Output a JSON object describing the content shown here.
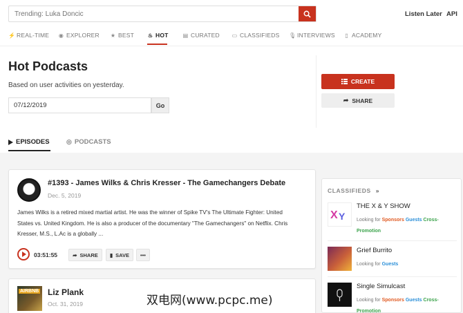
{
  "search": {
    "placeholder": "Trending: Luka Doncic"
  },
  "top_links": {
    "listen_later": "Listen Later",
    "api": "API"
  },
  "nav": [
    {
      "label": "REAL-TIME",
      "icon": "bolt-icon"
    },
    {
      "label": "EXPLORER",
      "icon": "compass-icon"
    },
    {
      "label": "BEST",
      "icon": "star-icon"
    },
    {
      "label": "HOT",
      "icon": "flame-icon",
      "active": true
    },
    {
      "label": "CURATED",
      "icon": "list-icon"
    },
    {
      "label": "CLASSIFIEDS",
      "icon": "card-icon"
    },
    {
      "label": "INTERVIEWS",
      "icon": "microphone-icon"
    },
    {
      "label": "ACADEMY",
      "icon": "book-icon"
    }
  ],
  "hero": {
    "title": "Hot Podcasts",
    "subtitle": "Based on user activities on yesterday.",
    "date_value": "07/12/2019",
    "go_label": "Go",
    "create_label": "CREATE",
    "share_label": "SHARE"
  },
  "tabs": {
    "episodes": "EPISODES",
    "podcasts": "PODCASTS"
  },
  "episodes": [
    {
      "title": "#1393 - James Wilks & Chris Kresser - The Gamechangers Debate",
      "date": "Dec. 5, 2019",
      "desc_lines": [
        "James Wilks is a retired mixed martial artist. He was the winner of Spike TV's The Ultimate Fighter: United",
        "States vs. United Kingdom. He is also a producer of the documentary \"The Gamechangers\" on Netflix. Chris",
        "Kresser, M.S., L.Ac is a globally ..."
      ],
      "duration": "03:51:55",
      "share_label": "SHARE",
      "save_label": "SAVE",
      "more_label": "•••"
    },
    {
      "title": "Liz Plank",
      "date": "Oct. 31, 2019",
      "art_tag": "AIRBNB"
    }
  ],
  "classifieds": {
    "heading": "CLASSIFIEDS",
    "looking_for": "Looking for",
    "items": [
      {
        "name": "THE X & Y SHOW",
        "wants": [
          "Sponsors",
          "Guests",
          "Cross-Promotion"
        ]
      },
      {
        "name": "Grief Burrito",
        "wants": [
          "Guests"
        ]
      },
      {
        "name": "Single Simulcast",
        "wants": [
          "Sponsors",
          "Guests",
          "Cross-Promotion"
        ]
      }
    ]
  },
  "watermark": "双电网(www.pcpc.me)",
  "colors": {
    "accent": "#c8321e",
    "sponsors": "#e05a22",
    "guests": "#2b8fd8",
    "cross": "#3aa24a"
  }
}
